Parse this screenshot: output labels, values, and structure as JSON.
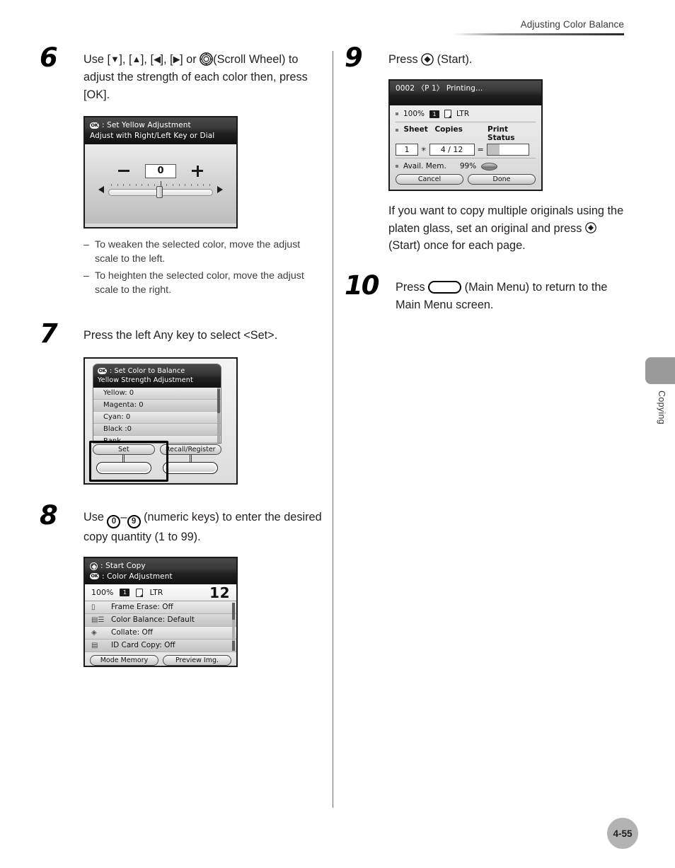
{
  "header": {
    "running_head": "Adjusting Color Balance"
  },
  "side_tab": {
    "label": "Copying"
  },
  "folio": {
    "page_number": "4-55"
  },
  "steps": {
    "six": {
      "number": "6",
      "text_part1": "Use [",
      "text_part2": "], [",
      "text_part3": "], [",
      "text_part4": "], [",
      "text_part5": "] or ",
      "text_part6": "(Scroll Wheel) to adjust the strength of each color then, press [OK].",
      "full_text": "Use [▼], [▲], [◀], [▶] or (Scroll Wheel) to adjust the strength of each color then, press [OK].",
      "screen": {
        "title_line1": ": Set Yellow Adjustment",
        "title_line2": "Adjust with Right/Left Key or Dial",
        "ok_badge": "OK",
        "minus_label": "−",
        "plus_label": "+",
        "value": "0"
      },
      "notes": [
        {
          "dash": "–",
          "text": "To weaken the selected color, move the adjust scale to the left."
        },
        {
          "dash": "–",
          "text": "To heighten the selected color, move the adjust scale to the right."
        }
      ]
    },
    "seven": {
      "number": "7",
      "text": "Press the left Any key to select <Set>.",
      "screen": {
        "title_line1": ": Set Color to Balance",
        "title_line2": "Yellow Strength Adjustment",
        "ok_badge": "OK",
        "items": [
          "Yellow: 0",
          "Magenta: 0",
          "Cyan: 0",
          "Black :0",
          "Rank"
        ],
        "buttons": [
          "Set",
          "Recall/Register"
        ]
      }
    },
    "eight": {
      "number": "8",
      "text_lead": "Use ",
      "key_from": "0",
      "key_dash": "–",
      "key_to": "9",
      "text_tail": " (numeric keys) to enter the desired copy quantity (1 to 99).",
      "screen": {
        "title_line1": ": Start Copy",
        "title_line2": ": Color Adjustment",
        "ok_badge": "OK",
        "zoom": "100",
        "percent": "%",
        "paper_count": "1",
        "paper_size": "LTR",
        "quantity": "12",
        "items": [
          "Frame Erase: Off",
          "Color Balance: Default",
          "Collate: Off",
          "ID Card Copy: Off"
        ],
        "buttons": [
          "Mode Memory",
          "Preview Img."
        ]
      }
    },
    "nine": {
      "number": "9",
      "text_lead": "Press ",
      "text_tail": " (Start).",
      "screen": {
        "title": "0002 〈P  1〉 Printing...",
        "zoom": "100",
        "percent": "%",
        "paper_count": "1",
        "paper_size": "LTR",
        "col_sheet": "Sheet",
        "col_copies": "Copies",
        "col_status": "Print Status",
        "sheet_value": "1",
        "mult_symbol": "✳",
        "copies_value": "4 / 12",
        "equals": "=",
        "mem_label": "Avail. Mem.",
        "mem_value": "99",
        "mem_percent": "%",
        "buttons": [
          "Cancel",
          "Done"
        ]
      },
      "note_part1": "If you want to copy multiple originals using the platen glass, set an original and press ",
      "note_part2": " (Start) once for each page."
    },
    "ten": {
      "number": "10",
      "text_lead": "Press ",
      "text_tail": " (Main Menu) to return to the Main Menu screen."
    }
  }
}
